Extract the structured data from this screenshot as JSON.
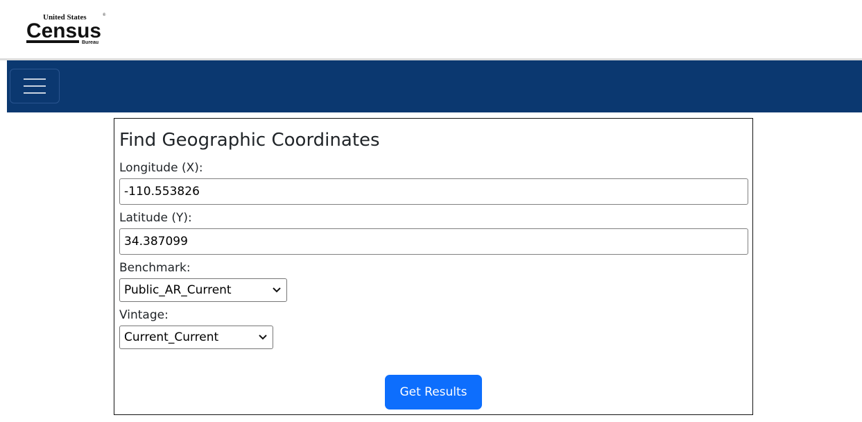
{
  "branding": {
    "logo_line1": "United States",
    "logo_reg": "®",
    "logo_main": "Census",
    "logo_line3": "Bureau"
  },
  "navbar": {
    "menu_icon": "hamburger-menu-icon",
    "background_color": "#0b3870"
  },
  "form": {
    "title": "Find Geographic Coordinates",
    "longitude": {
      "label": "Longitude (X):",
      "value": "-110.553826"
    },
    "latitude": {
      "label": "Latitude (Y):",
      "value": "34.387099"
    },
    "benchmark": {
      "label": "Benchmark:",
      "selected": "Public_AR_Current"
    },
    "vintage": {
      "label": "Vintage:",
      "selected": "Current_Current"
    },
    "submit_label": "Get Results",
    "accent_color": "#0d6efd"
  }
}
